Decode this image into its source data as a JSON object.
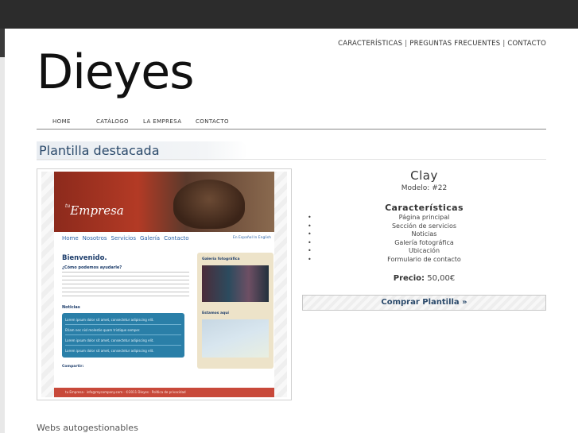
{
  "top_links": [
    "CARACTERÍSTICAS",
    "PREGUNTAS FRECUENTES",
    "CONTACTO"
  ],
  "logo": "Dieyes",
  "nav": [
    "HOME",
    "CATÁLOGO",
    "LA EMPRESA",
    "CONTACTO"
  ],
  "section_title": "Plantilla destacada",
  "preview": {
    "brand_small": "tu",
    "brand": "Empresa",
    "nav": [
      "Home",
      "Nosotros",
      "Servicios",
      "Galería",
      "Contacto"
    ],
    "flags": [
      "En Español",
      "In English"
    ],
    "welcome": "Bienvenido.",
    "subtitle": "¿Cómo podemos ayudarle?",
    "noticias": "Noticias",
    "news": [
      "Lorem ipsum dolor sit amet, consectetur adipiscing elit.",
      "Etiam nec nisl molestie quam tristique semper.",
      "Lorem ipsum dolor sit amet, consectetur adipiscing elit.",
      "Lorem ipsum dolor sit amet, consectetur adipiscing elit."
    ],
    "compartir": "Compartir:",
    "gallery_label": "Galería fotográfica",
    "location_label": "Estamos aquí",
    "footer": "tu Empresa · info@mycompany.com · ©2011 Dieyes · Política de privacidad"
  },
  "product": {
    "name": "Clay",
    "model": "Modelo: #22",
    "features_title": "Características",
    "features": [
      "Página principal",
      "Sección de servicios",
      "Noticias",
      "Galería fotográfica",
      "Ubicación",
      "Formulario de contacto"
    ],
    "price_label": "Precio:",
    "price_value": "50,00€",
    "buy_label": "Comprar Plantilla »"
  },
  "bottom_title": "Webs autogestionables"
}
